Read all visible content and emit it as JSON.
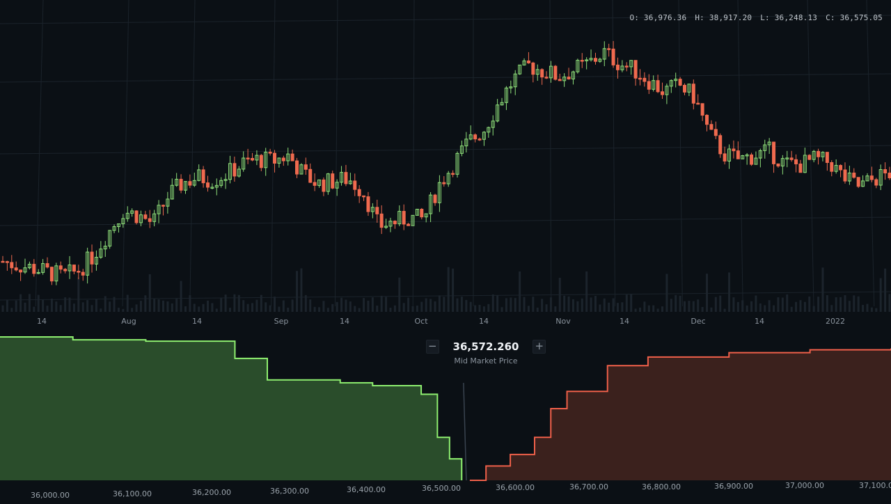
{
  "ohlc": {
    "open_label": "O:",
    "open": "36,976.36",
    "high_label": "H:",
    "high": "38,917.20",
    "low_label": "L:",
    "low": "36,248.13",
    "close_label": "C:",
    "close": "36,575.05"
  },
  "mid_market": {
    "price": "36,572.260",
    "label": "Mid Market Price",
    "minus_icon": "minus-icon",
    "plus_icon": "plus-icon"
  },
  "colors": {
    "background": "#0b1015",
    "up": "#8fe07a",
    "down": "#ef6a4f",
    "grid": "#1b232b",
    "bid_fill": "#2a4d2b",
    "bid_line": "#8ff070",
    "ask_fill": "#3b211d",
    "ask_line": "#f0604a"
  },
  "chart_data": [
    {
      "type": "candlestick",
      "x_tick_labels": [
        "14",
        "Aug",
        "14",
        "Sep",
        "14",
        "Oct",
        "14",
        "Nov",
        "14",
        "Dec",
        "14",
        "2022"
      ],
      "ylim": [
        28000,
        48000
      ],
      "grid": true,
      "close_series": [
        30800,
        30500,
        30300,
        30000,
        29700,
        30100,
        31200,
        32900,
        34500,
        34200,
        33600,
        35600,
        36600,
        37000,
        36800,
        37300,
        38000,
        38300,
        38200,
        38600,
        37200,
        36500,
        36700,
        36900,
        35900,
        33400,
        33700,
        34000,
        33900,
        36400,
        38000,
        39600,
        40500,
        42500,
        44200,
        45200,
        44800,
        44400,
        44900,
        45400,
        46200,
        45400,
        44900,
        44100,
        43300,
        43800,
        42900,
        40200,
        38700,
        38300,
        38600,
        38900,
        38000,
        37900,
        38300,
        38100,
        36900,
        36300,
        36900,
        37300
      ],
      "volume_visible": true
    },
    {
      "type": "area",
      "title": "",
      "x_tick_labels": [
        "36,000.00",
        "36,100.00",
        "36,200.00",
        "36,300.00",
        "36,400.00",
        "36,500.00",
        "36,600.00",
        "36,700.00",
        "36,800.00",
        "36,900.00",
        "37,000.00",
        "37,100.00"
      ],
      "xlim": [
        36000,
        37100
      ],
      "mid_price": 36572.26,
      "series": [
        {
          "side": "bids",
          "x": [
            36000,
            36090,
            36180,
            36200,
            36290,
            36330,
            36330,
            36420,
            36460,
            36520,
            36540,
            36555,
            36570
          ],
          "y": [
            100,
            98,
            97,
            97,
            85,
            85,
            70,
            68,
            66,
            60,
            30,
            15,
            0
          ]
        },
        {
          "side": "asks",
          "x": [
            36580,
            36600,
            36630,
            36660,
            36680,
            36700,
            36750,
            36800,
            36900,
            37000,
            37100
          ],
          "y": [
            0,
            10,
            18,
            30,
            50,
            62,
            80,
            86,
            89,
            91,
            92
          ]
        }
      ]
    }
  ]
}
